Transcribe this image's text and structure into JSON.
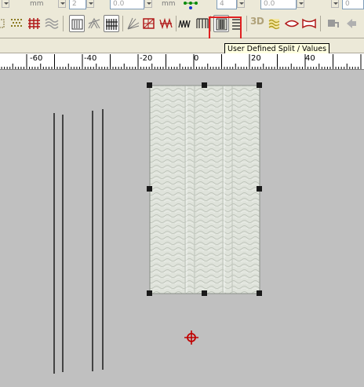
{
  "top_fields": {
    "unit1": "mm",
    "unit2": "mm",
    "field1_value": "2",
    "field2_value": "0.0",
    "field3_value": "4",
    "field4_value": "0.0",
    "field5_value": "0"
  },
  "toolbar": {
    "three_d_label": "3D",
    "tooltip_text": "User Defined Split / Values",
    "highlight_color": "#e02020",
    "buttons": [
      "tatami-fill-icon",
      "cross-hatch-fill-icon",
      "wave-fill-icon",
      "satin-split-icon",
      "motif-fill-icon",
      "parallel-lines-icon",
      "radial-fill-icon",
      "grid-fill-icon",
      "zigzag-fill-icon",
      "pattern-fill-icon",
      "user-defined-split-icon",
      "horizontal-lines-icon",
      "3d-icon",
      "wave-effect-icon",
      "envelope-icon",
      "envelope-alt-icon"
    ]
  },
  "ruler": {
    "labels": [
      "-60",
      "-40",
      "-20",
      "0",
      "20",
      "40"
    ]
  },
  "canvas": {
    "background_color": "#c0c0c0",
    "selection_handle_color": "#1a1a1a",
    "cross_icon_color": "#c00000"
  }
}
